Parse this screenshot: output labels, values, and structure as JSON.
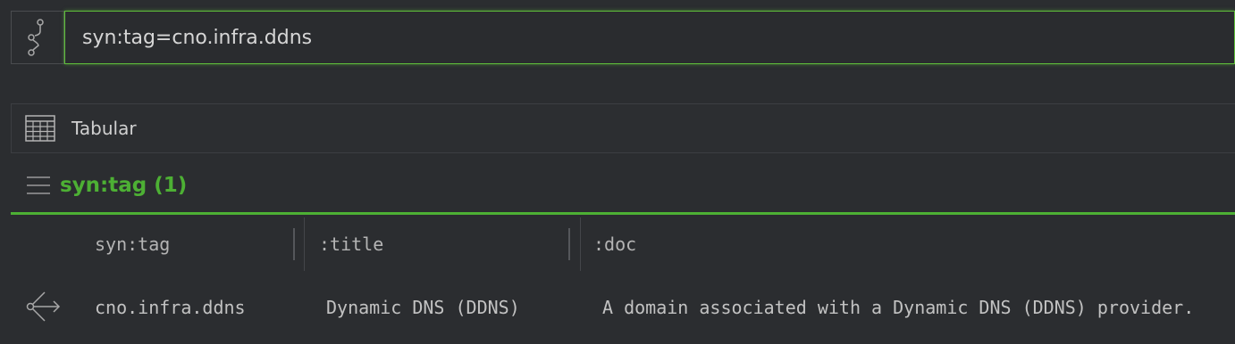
{
  "query": {
    "mode_icon": "git-branch-icon",
    "value": "syn:tag=cno.infra.ddns"
  },
  "view": {
    "icon": "table-icon",
    "label": "Tabular"
  },
  "section": {
    "icon": "menu-icon",
    "title": "syn:tag (1)"
  },
  "table": {
    "columns": [
      "syn:tag",
      ":title",
      ":doc"
    ],
    "rows": [
      {
        "icon": "share-node-icon",
        "cells": [
          "cno.infra.ddns",
          "Dynamic DNS (DDNS)",
          "A domain associated with a Dynamic DNS (DDNS) provider."
        ]
      }
    ]
  },
  "colors": {
    "accent": "#4db034",
    "background": "#2b2d30"
  }
}
